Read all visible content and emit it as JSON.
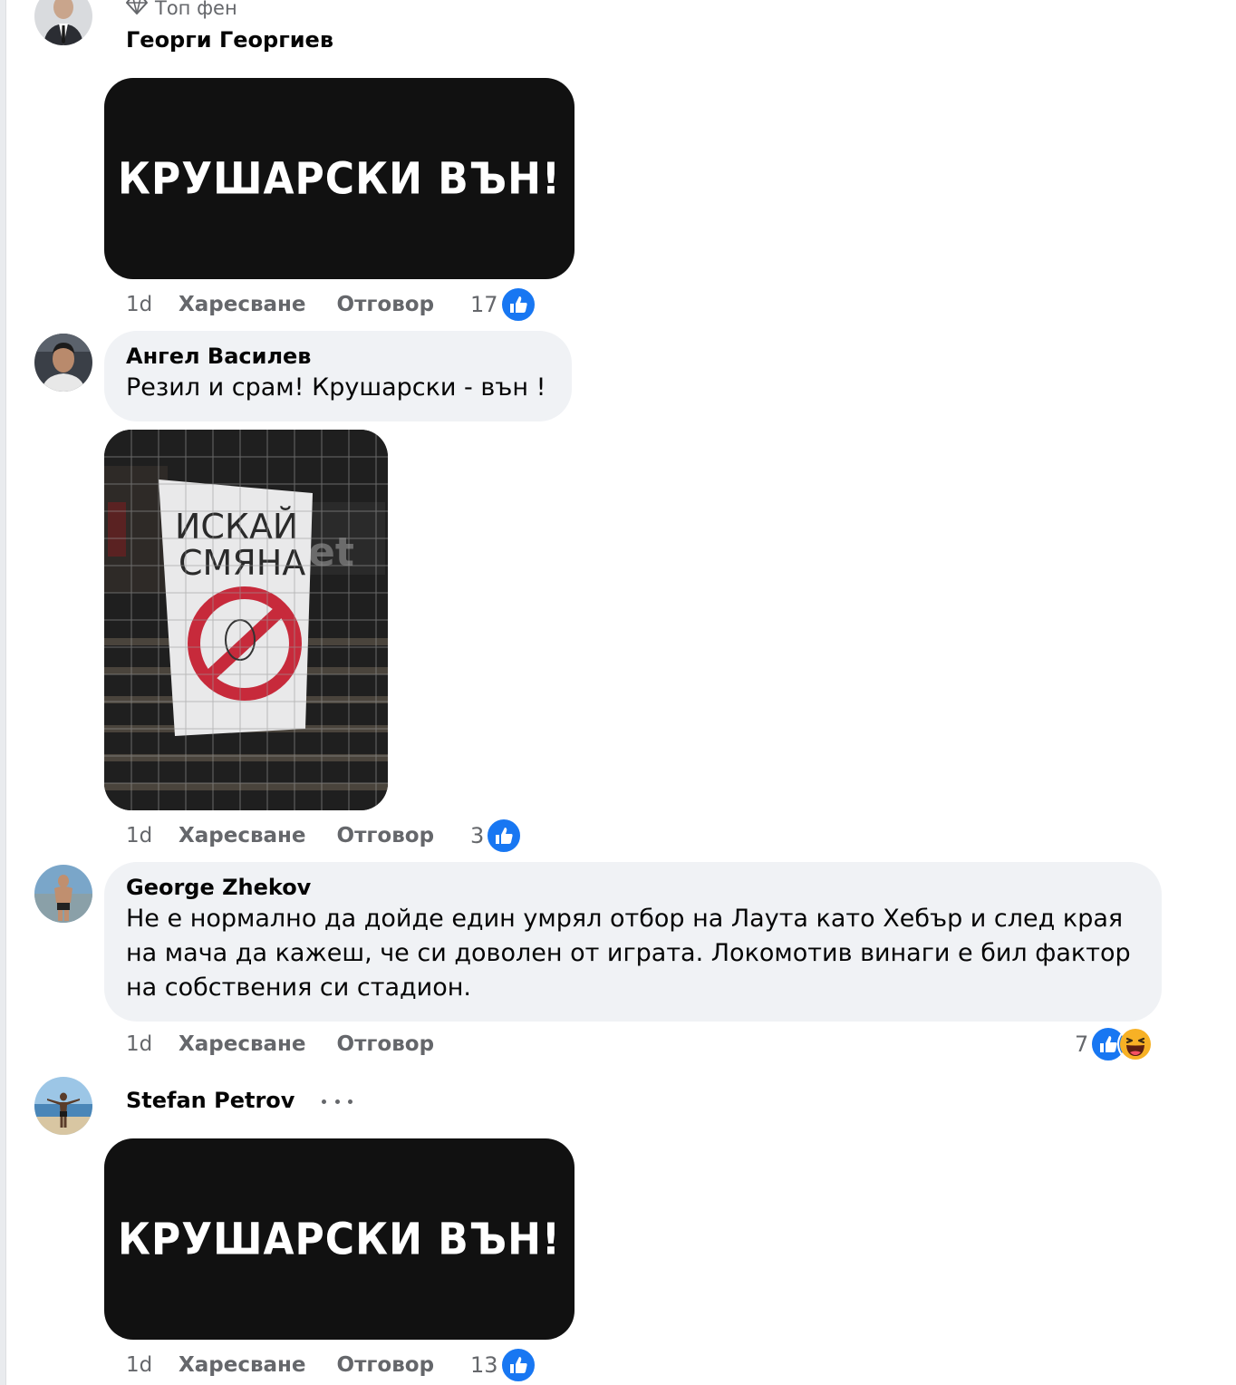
{
  "comments": [
    {
      "badge": "Топ фен",
      "author": "Георги Георгиев",
      "image_text": "КРУШАРСКИ  ВЪН!",
      "time": "1d",
      "like_label": "Харесване",
      "reply_label": "Отговор",
      "reactions_count": "17",
      "reactions": [
        "like-icon"
      ]
    },
    {
      "author": "Ангел Василев",
      "text": "Резил и срам! Крушарски - вън !",
      "time": "1d",
      "like_label": "Харесване",
      "reply_label": "Отговор",
      "reactions_count": "3",
      "reactions": [
        "like-icon"
      ]
    },
    {
      "author": "George Zhekov",
      "text": "Не е нормално да дойде един умрял отбор на Лаута като Хебър и след края на мача да кажеш, че си доволен от играта. Локомотив винаги е бил фактор на собствения си стадион.",
      "time": "1d",
      "like_label": "Харесване",
      "reply_label": "Отговор",
      "reactions_count": "7",
      "reactions": [
        "like-icon",
        "haha-icon"
      ]
    },
    {
      "author": "Stefan Petrov",
      "image_text": "КРУШАРСКИ  ВЪН!",
      "time": "1d",
      "like_label": "Харесване",
      "reply_label": "Отговор",
      "reactions_count": "13",
      "reactions": [
        "like-icon"
      ]
    }
  ],
  "colors": {
    "like_blue": "#1877f2",
    "bubble_bg": "#f0f2f5",
    "secondary_text": "#65676b"
  }
}
